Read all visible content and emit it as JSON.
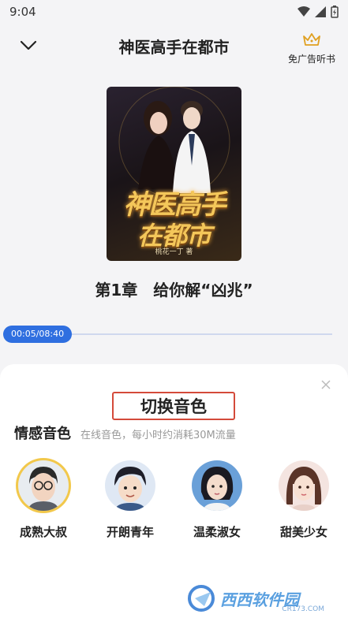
{
  "status": {
    "time": "9:04"
  },
  "header": {
    "title": "神医高手在都市",
    "vip_label": "免广告听书"
  },
  "cover": {
    "title_line1": "神医高手",
    "title_line2": "在都市",
    "author": "桃花一丁 著"
  },
  "chapter": {
    "title": "第1章　给你解“凶兆”"
  },
  "progress": {
    "time_text": "00:05/08:40",
    "fraction": 0.01
  },
  "sheet": {
    "title": "切换音色",
    "section_title": "情感音色",
    "section_subtitle": "在线音色，每小时约消耗30M流量",
    "voices": [
      {
        "label": "成熟大叔",
        "selected": true
      },
      {
        "label": "开朗青年",
        "selected": false
      },
      {
        "label": "温柔淑女",
        "selected": false
      },
      {
        "label": "甜美少女",
        "selected": false
      }
    ]
  },
  "watermark": {
    "text": "西西软件园",
    "sub": "CR173.COM"
  },
  "colors": {
    "accent": "#2f6fe0",
    "highlight_border": "#d44a3a",
    "selected_ring": "#f2c84b"
  }
}
